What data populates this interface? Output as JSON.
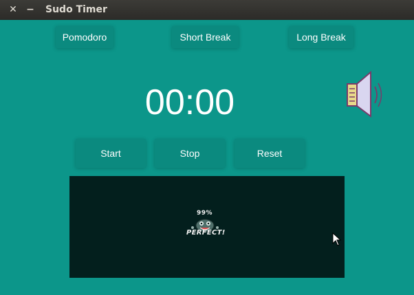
{
  "window": {
    "title": "Sudo Timer",
    "close_glyph": "✕",
    "minimize_glyph": "−"
  },
  "modes": {
    "pomodoro": "Pomodoro",
    "short_break": "Short Break",
    "long_break": "Long Break"
  },
  "timer": {
    "display": "00:00"
  },
  "controls": {
    "start": "Start",
    "stop": "Stop",
    "reset": "Reset"
  },
  "sound": {
    "icon": "speaker-volume-icon"
  },
  "display_screen": {
    "percent": "99%",
    "message": "PERFECT!",
    "mascot_icon": "smiling-face-icon"
  },
  "colors": {
    "background": "#0c968a",
    "button": "#0b8a7f",
    "screen": "#031f1d",
    "titlebar": "#3c3b37"
  }
}
